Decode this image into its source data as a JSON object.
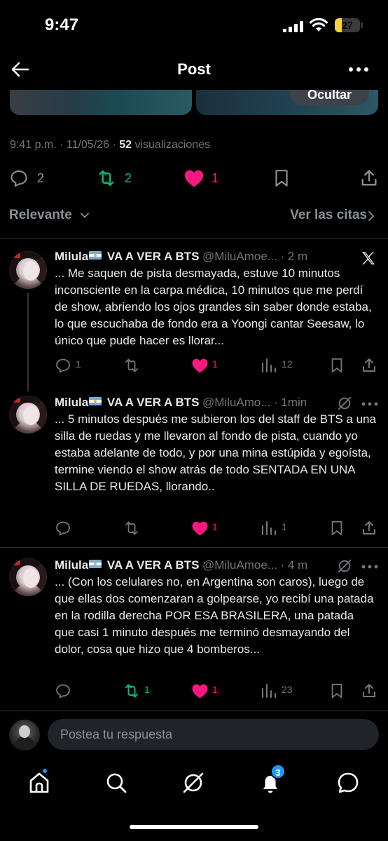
{
  "status_bar": {
    "time": "9:47",
    "battery": "27",
    "battery_level": 0.27
  },
  "header": {
    "title": "Post",
    "back_icon": "arrow-left-icon",
    "more_icon": "more-horizontal-icon"
  },
  "media": {
    "hide_label": "Ocultar"
  },
  "meta": {
    "time": "9:41 p.m. · 11/05/26 · ",
    "views_count": "52",
    "views_label": " visualizaciones"
  },
  "main_actions": {
    "replies": "2",
    "reposts": "2",
    "likes": "1"
  },
  "sort": {
    "left_label": "Relevante",
    "right_label": "Ver las citas"
  },
  "posts": [
    {
      "name": "Milula",
      "name_suffix": " VA A VER A BTS",
      "handle": "@MiluAmoe...",
      "time": "· 2 m",
      "corner_icon": "x-logo-icon",
      "text": "... Me saquen de pista desmayada, estuve 10 minutos inconsciente en la carpa médica, 10 minutos que me perdí de show, abriendo los ojos grandes sin saber donde estaba, lo que escuchaba de fondo era a Yoongi cantar Seesaw, lo único que pude hacer es llorar...",
      "replies": "1",
      "reposts": "",
      "likes": "1",
      "views": "12"
    },
    {
      "name": "Milula",
      "name_suffix": " VA A VER A BTS",
      "handle": "@MiluAmo...",
      "time": "· 1min",
      "corner_icon": "grok-icon",
      "text": "... 5 minutos después me subieron los del staff de BTS a una silla de ruedas y me llevaron al fondo de pista, cuando yo estaba adelante de todo, y por una mina estúpida y egoísta, termine viendo el show atrás de todo SENTADA EN UNA SILLA DE RUEDAS, llorando..",
      "replies": "",
      "reposts": "",
      "likes": "1",
      "views": "1"
    },
    {
      "name": "Milula",
      "name_suffix": " VA A VER A BTS",
      "handle": "@MiluAmoe...",
      "time": "· 4 m",
      "corner_icon": "grok-icon",
      "text": "... (Con los celulares no, en Argentina son caros), luego de que ellas dos comenzaran a golpearse, yo recibí una patada en la rodilla derecha POR ESA BRASILERA, una patada que  casi 1 minuto después me terminó desmayando del dolor, cosa que hizo que 4 bomberos...",
      "replies": "",
      "reposts": "1",
      "likes": "1",
      "views": "23"
    }
  ],
  "reply": {
    "placeholder": "Postea tu respuesta"
  },
  "tabbar": {
    "notifications_badge": "3"
  },
  "colors": {
    "like": "#f91880",
    "repost": "#00ba7c",
    "accent": "#1d9bf0",
    "muted": "#71767b"
  }
}
